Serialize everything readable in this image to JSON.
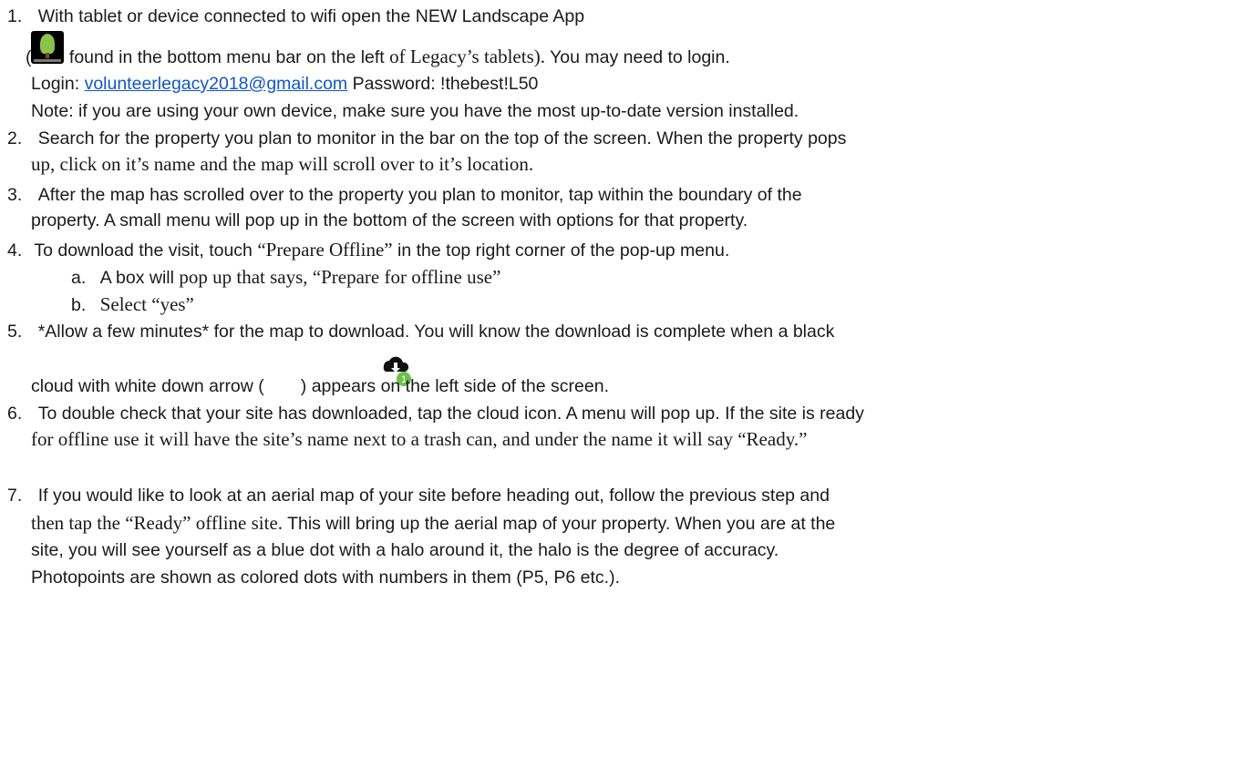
{
  "steps": {
    "s1": {
      "num": "1.",
      "line1": "With tablet or device connected to wifi open the NEW Landscape App",
      "paren_open": "(",
      "line2a": " found in the bottom menu bar on the left ",
      "line2b": "of Legacy’s tablets).",
      "line2c": " You may need to login.",
      "login_label": "Login: ",
      "login_email": "volunteerlegacy2018@gmail.com",
      "password_text": "  Password: !thebest!L50",
      "note": "Note: if you are using your own device, make sure you have the most up-to-date version installed."
    },
    "s2": {
      "num": "2.",
      "line1": "Search for the property you plan to monitor in the bar on the top of the screen. When the property pops",
      "line2": "up, click on it’s name and the map will scroll over to it’s location."
    },
    "s3": {
      "num": "3.",
      "line1": "After the map has scrolled over to the property you plan to monitor, tap within the boundary of the",
      "line2": "property. A small menu will pop up in the bottom of the screen with options for that property."
    },
    "s4": {
      "num": "4.",
      "line1a": " To download the visit, touch ",
      "line1b": "“Prepare Offline”",
      "line1c": " in the top right corner of the pop-up menu.",
      "a_label": "a.",
      "a_text1": "A box will ",
      "a_text2": "pop up that says, “Prepare for offline use”",
      "b_label": "b.",
      "b_text": "Select “yes”"
    },
    "s5": {
      "num": "5.",
      "line1": "*Allow a few minutes* for the map to download. You will know the download is complete when a black",
      "line2a": "cloud with white down arrow (",
      "cloud_badge": "1",
      "line2b": ") appears on the left side of the screen."
    },
    "s6": {
      "num": "6.",
      "line1": "To double check that your site has downloaded, tap the cloud icon. A menu will pop up. If the site is ready",
      "line2": "for offline use it will have the site’s name next to a trash can, and under the name it will say “Ready.”"
    },
    "s7": {
      "num": "7.",
      "line1": "If you would like to look at an aerial map of your site before heading out, follow the previous step and",
      "line2a": "then tap the “Ready” offline site.",
      "line2b": "   This will bring up the aerial map of your property. When you are at the",
      "line3": "site, you will see yourself as a blue dot with a halo around it, the halo is the degree of accuracy.",
      "line4": "Photopoints are shown as colored dots with numbers in them (P5, P6 etc.)."
    }
  },
  "icons": {
    "app": "landscape-app-icon",
    "cloud": "cloud-download-icon"
  },
  "colors": {
    "link": "#1155cc",
    "badge": "#6cc04a",
    "app_tree": "#8bc34a"
  }
}
